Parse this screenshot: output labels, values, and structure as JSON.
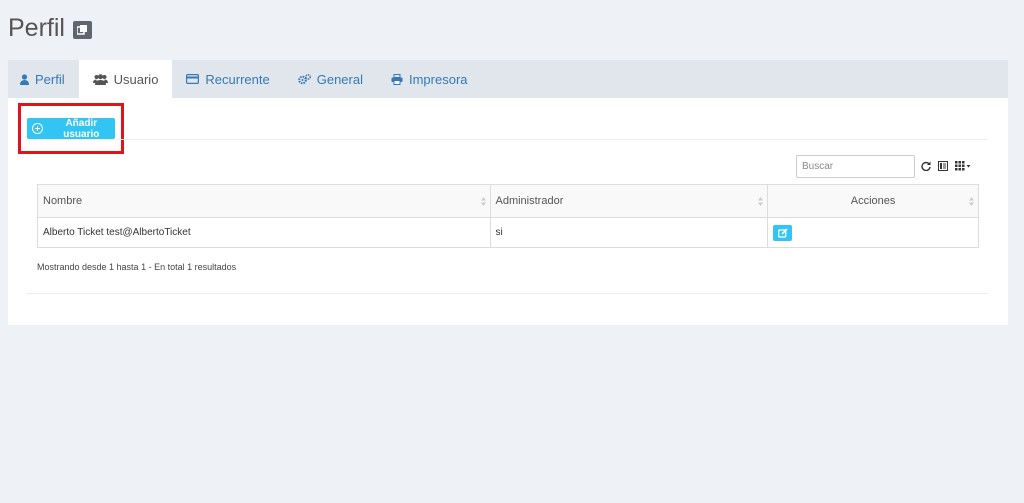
{
  "page": {
    "title": "Perfil"
  },
  "tabs": [
    {
      "label": "Perfil",
      "icon": "user-icon",
      "active": false
    },
    {
      "label": "Usuario",
      "icon": "users-icon",
      "active": true
    },
    {
      "label": "Recurrente",
      "icon": "credit-card-icon",
      "active": false
    },
    {
      "label": "General",
      "icon": "gears-icon",
      "active": false
    },
    {
      "label": "Impresora",
      "icon": "printer-icon",
      "active": false
    }
  ],
  "toolbar": {
    "add_label": "Añadir usuario"
  },
  "search": {
    "placeholder": "Buscar",
    "value": ""
  },
  "table": {
    "headers": [
      "Nombre",
      "Administrador",
      "Acciones"
    ],
    "rows": [
      {
        "nombre": "Alberto Ticket test@AlbertoTicket",
        "administrador": "si"
      }
    ]
  },
  "summary": "Mostrando desde 1 hasta 1 - En total 1 resultados",
  "colors": {
    "accent": "#32c5f4",
    "link": "#337ab7",
    "highlight": "#e0141e"
  }
}
